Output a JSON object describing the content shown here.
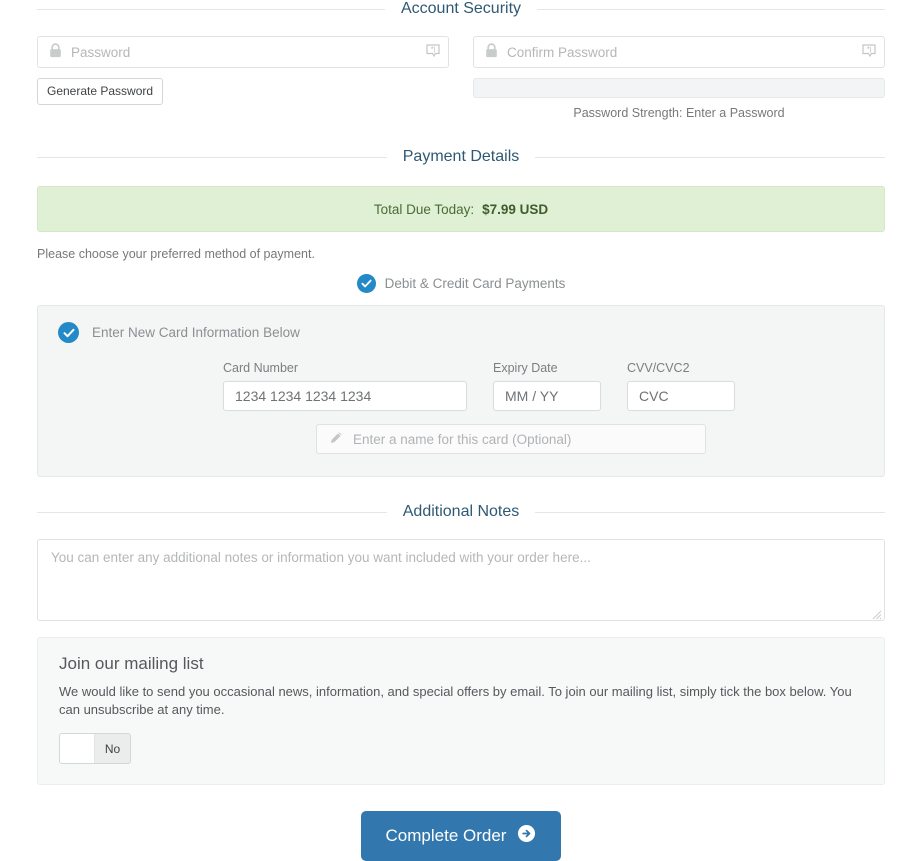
{
  "sections": {
    "account_security": {
      "legend": "Account Security",
      "password": {
        "placeholder": "Password",
        "lock_icon": "lock-icon",
        "generate_icon": "password-generator-icon"
      },
      "confirm_password": {
        "placeholder": "Confirm Password",
        "lock_icon": "lock-icon",
        "generate_icon": "password-generator-icon"
      },
      "generate_button": "Generate Password",
      "strength_label": "Password Strength: Enter a Password",
      "strength_percent": 0
    },
    "payment_details": {
      "legend": "Payment Details",
      "total_label": "Total Due Today:",
      "total_amount": "$7.99 USD",
      "hint": "Please choose your preferred method of payment.",
      "method": {
        "label": "Debit & Credit Card Payments",
        "icon": "check-circle-icon",
        "selected": true
      },
      "card_panel": {
        "heading": "Enter New Card Information Below",
        "heading_icon": "check-circle-icon",
        "selected": true,
        "card_number_label": "Card Number",
        "card_number_placeholder": "1234 1234 1234 1234",
        "expiry_label": "Expiry Date",
        "expiry_placeholder": "MM / YY",
        "cvv_label": "CVV/CVC2",
        "cvv_placeholder": "CVC",
        "card_name_placeholder": "Enter a name for this card (Optional)",
        "card_name_icon": "pencil-icon"
      }
    },
    "additional_notes": {
      "legend": "Additional Notes",
      "placeholder": "You can enter any additional notes or information you want included with your order here...",
      "value": "",
      "resize_icon": "resize-grip-icon"
    },
    "mailing_list": {
      "title": "Join our mailing list",
      "body": "We would like to send you occasional news, information, and special offers by email. To join our mailing list, simply tick the box below. You can unsubscribe at any time.",
      "toggle_state": "No"
    },
    "submit": {
      "label": "Complete Order",
      "icon": "arrow-right-circle-icon"
    }
  },
  "colors": {
    "legend": "#2f5973",
    "accent_blue": "#2489c7",
    "button_blue": "#3278ae",
    "success_bg": "#dff0d5",
    "success_text": "#4a6b36"
  }
}
